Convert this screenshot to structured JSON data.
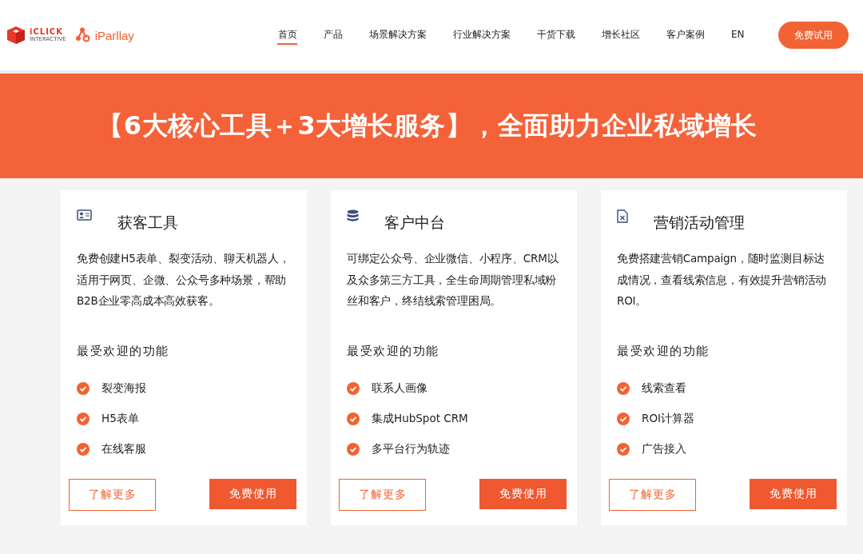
{
  "logo": {
    "brand_1": "iCLICK",
    "brand_1_sub": "INTERACTIVE",
    "brand_2": "iParllay"
  },
  "nav": {
    "items": [
      {
        "label": "首页",
        "selected": true
      },
      {
        "label": "产品",
        "selected": false
      },
      {
        "label": "场景解决方案",
        "selected": false
      },
      {
        "label": "行业解决方案",
        "selected": false
      },
      {
        "label": "干货下载",
        "selected": false
      },
      {
        "label": "增长社区",
        "selected": false
      },
      {
        "label": "客户案例",
        "selected": false
      },
      {
        "label": "EN",
        "selected": false
      }
    ],
    "cta": "免费试用"
  },
  "banner": {
    "title": "【6大核心工具＋3大增长服务】，全面助力企业私域增长"
  },
  "cards": [
    {
      "kind": "contact",
      "title": "获客工具",
      "description": "免费创建H5表单、裂变活动、聊天机器人，适用于网页、企微、公众号多种场景，帮助B2B企业零高成本高效获客。",
      "features_heading": "最受欢迎的功能",
      "features": [
        "裂变海报",
        "H5表单",
        "在线客服"
      ],
      "learn_more": "了解更多",
      "try_free": "免费使用"
    },
    {
      "kind": "data",
      "title": "客户中台",
      "description": "可绑定公众号、企业微信、小程序、CRM以及众多第三方工具，全生命周期管理私域粉丝和客户，终结线索管理困局。",
      "features_heading": "最受欢迎的功能",
      "features": [
        "联系人画像",
        "集成HubSpot CRM",
        "多平台行为轨迹"
      ],
      "learn_more": "了解更多",
      "try_free": "免费使用"
    },
    {
      "kind": "marketing",
      "title": "营销活动管理",
      "description": "免费搭建营销Campaign，随时监测目标达成情况，查看线索信息，有效提升营销活动ROI。",
      "features_heading": "最受欢迎的功能",
      "features": [
        "线索查看",
        "ROI计算器",
        "广告接入"
      ],
      "learn_more": "了解更多",
      "try_free": "免费使用"
    }
  ]
}
